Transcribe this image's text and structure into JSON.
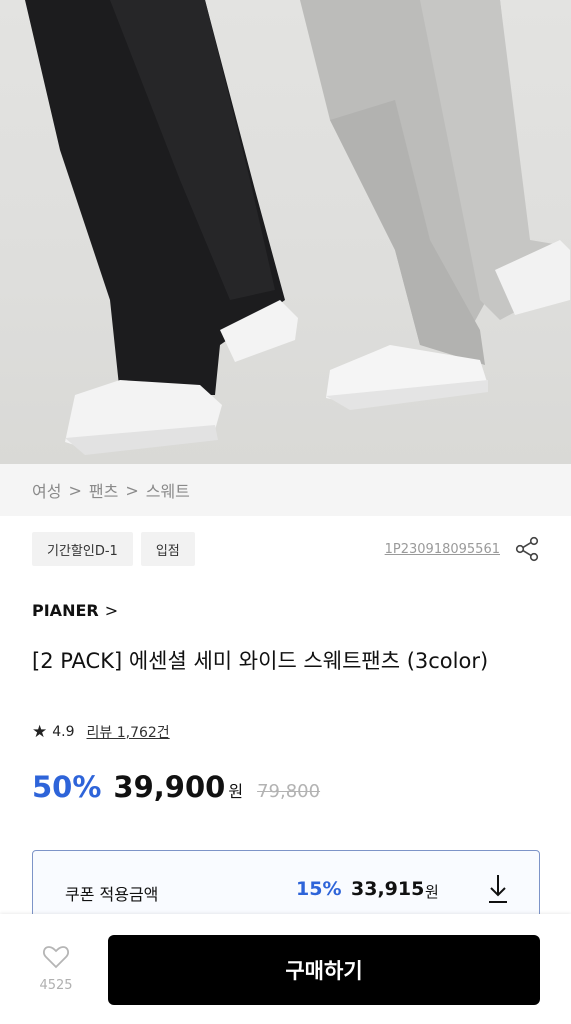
{
  "breadcrumb": {
    "items": [
      "여성",
      "팬츠",
      "스웨트"
    ],
    "separator": ">"
  },
  "tags": [
    "기간할인D-1",
    "입점"
  ],
  "product_code": "1P230918095561",
  "brand": {
    "name": "PIANER",
    "chevron": ">"
  },
  "title": "[2 PACK] 에센셜 세미 와이드 스웨트팬츠 (3color)",
  "rating": {
    "star": "★",
    "score": "4.9",
    "reviews": "리뷰 1,762건"
  },
  "price": {
    "discount": "50%",
    "sale": "39,900",
    "unit": "원",
    "original": "79,800"
  },
  "coupon": {
    "label": "쿠폰 적용금액",
    "discount": "15%",
    "price": "33,915",
    "unit": "원",
    "icon": "download-icon"
  },
  "bottom": {
    "like_count": "4525",
    "buy_label": "구매하기"
  },
  "colors": {
    "accent": "#2e64d9",
    "button": "#000000",
    "coupon_border": "#7d94c8"
  }
}
